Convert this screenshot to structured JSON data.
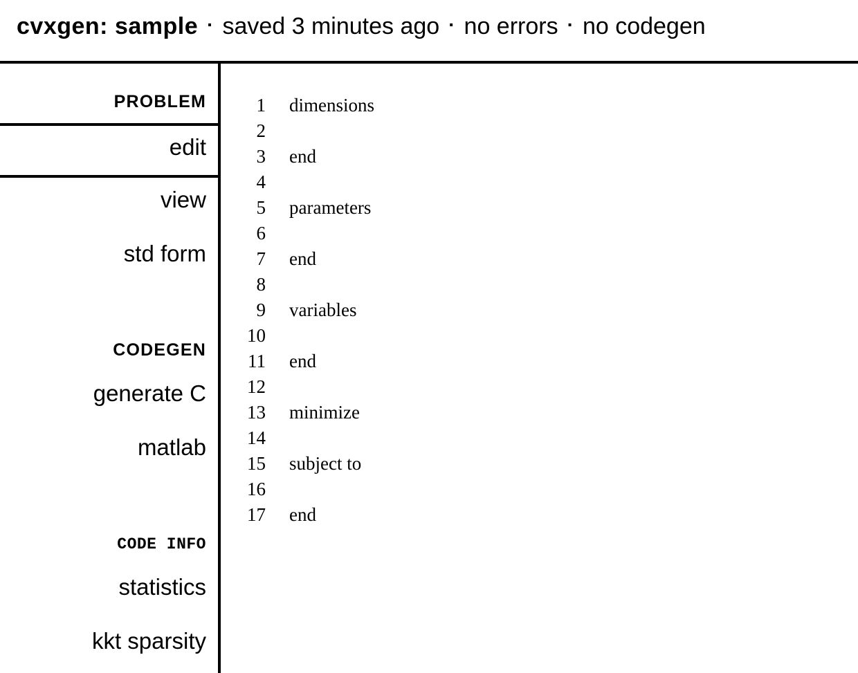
{
  "header": {
    "app_title": "cvxgen: sample",
    "separator": "·",
    "status_items": [
      "saved 3 minutes ago",
      "no errors",
      "no codegen"
    ]
  },
  "sidebar": {
    "sections": [
      {
        "heading": "PROBLEM",
        "items": [
          {
            "label": "edit"
          },
          {
            "label": "view"
          },
          {
            "label": "std form"
          }
        ]
      },
      {
        "heading": "CODEGEN",
        "items": [
          {
            "label": "generate C"
          },
          {
            "label": "matlab"
          }
        ]
      },
      {
        "heading": "CODE INFO",
        "items": [
          {
            "label": "statistics"
          },
          {
            "label": "kkt sparsity"
          }
        ]
      }
    ]
  },
  "editor": {
    "lines": [
      {
        "number": "1",
        "text": "dimensions"
      },
      {
        "number": "2",
        "text": ""
      },
      {
        "number": "3",
        "text": "end"
      },
      {
        "number": "4",
        "text": ""
      },
      {
        "number": "5",
        "text": "parameters"
      },
      {
        "number": "6",
        "text": ""
      },
      {
        "number": "7",
        "text": "end"
      },
      {
        "number": "8",
        "text": ""
      },
      {
        "number": "9",
        "text": "variables"
      },
      {
        "number": "10",
        "text": ""
      },
      {
        "number": "11",
        "text": "end"
      },
      {
        "number": "12",
        "text": ""
      },
      {
        "number": "13",
        "text": "minimize"
      },
      {
        "number": "14",
        "text": ""
      },
      {
        "number": "15",
        "text": "subject to"
      },
      {
        "number": "16",
        "text": ""
      },
      {
        "number": "17",
        "text": "end"
      }
    ]
  },
  "colors": {
    "background": "#ffffff",
    "foreground": "#000000",
    "rule": "#000000"
  }
}
